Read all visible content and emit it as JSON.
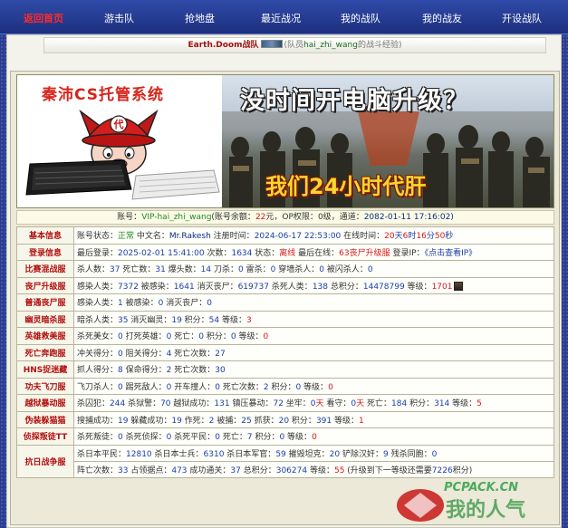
{
  "nav": {
    "home": "返回首页",
    "items": [
      "游击队",
      "抢地盘",
      "最近战况",
      "我的战队",
      "我的战友",
      "开设战队"
    ]
  },
  "subheader": {
    "team": "Earth.Doom",
    "team_suffix": "战队",
    "note_prefix": "(队员",
    "member": "hai_zhi_wang",
    "note_suffix": "的战斗经验)"
  },
  "banner": {
    "brand": "秦沛CS托管系统",
    "mascot_badge": "代",
    "headline": "没时间开电脑升级？",
    "tagline": "我们24小时代肝"
  },
  "account": {
    "label": "账号：",
    "name": "VIP-hai_zhi_wang",
    "balance_label": "(账号余额：",
    "balance": "22",
    "balance_unit": "元",
    "op_label": "OP权限：",
    "op": "0级",
    "channel_label": "通道：",
    "channel": "2082-01-11 17:16:02)"
  },
  "rows": [
    {
      "cat": "基本信息",
      "parts": [
        [
          "账号状态：",
          ""
        ],
        [
          "正常",
          "green"
        ],
        [
          " 中文名：",
          ""
        ],
        [
          "Mr.Rakesh",
          "darkblue"
        ],
        [
          " 注册时间：",
          ""
        ],
        [
          "2024-06-17 22:53:00",
          "blue"
        ],
        [
          " 在线时间：",
          ""
        ],
        [
          "20",
          "red"
        ],
        [
          "天",
          "blue"
        ],
        [
          "6",
          "red"
        ],
        [
          "时",
          "blue"
        ],
        [
          "16",
          "red"
        ],
        [
          "分",
          "blue"
        ],
        [
          "50",
          "red"
        ],
        [
          "秒",
          "blue"
        ]
      ]
    },
    {
      "cat": "登录信息",
      "parts": [
        [
          "最后登录：",
          ""
        ],
        [
          "2025-02-01 15:41:00",
          "blue"
        ],
        [
          " 次数：",
          ""
        ],
        [
          "1634",
          "blue"
        ],
        [
          " 状态：",
          ""
        ],
        [
          "离线",
          "red"
        ],
        [
          " 最后在线：",
          ""
        ],
        [
          "63丧尸升级服",
          "red"
        ],
        [
          " 登录IP：",
          ""
        ],
        [
          "《点击查看IP》",
          "blue"
        ]
      ]
    },
    {
      "cat": "比赛混战服",
      "parts": [
        [
          "杀人数：",
          ""
        ],
        [
          "37",
          "blue"
        ],
        [
          " 死亡数：",
          ""
        ],
        [
          "31",
          "blue"
        ],
        [
          " 爆头数：",
          ""
        ],
        [
          "14",
          "blue"
        ],
        [
          " 刀杀：",
          ""
        ],
        [
          "0",
          "blue"
        ],
        [
          " 雷杀：",
          ""
        ],
        [
          "0",
          "blue"
        ],
        [
          " 穿墙杀人：",
          ""
        ],
        [
          "0",
          "blue"
        ],
        [
          " 被闪杀人：",
          ""
        ],
        [
          "0",
          "blue"
        ]
      ]
    },
    {
      "cat": "丧尸升级服",
      "parts": [
        [
          "感染人类：",
          ""
        ],
        [
          "7372",
          "blue"
        ],
        [
          " 被感染：",
          ""
        ],
        [
          "1641",
          "blue"
        ],
        [
          " 消灭丧尸：",
          ""
        ],
        [
          "619737",
          "blue"
        ],
        [
          " 杀死人类：",
          ""
        ],
        [
          "138",
          "blue"
        ],
        [
          " 总积分：",
          ""
        ],
        [
          "14478799",
          "blue"
        ],
        [
          " 等级：",
          ""
        ],
        [
          "1701",
          "red"
        ]
      ],
      "avatar": true
    },
    {
      "cat": "普通丧尸服",
      "parts": [
        [
          "感染人类：",
          ""
        ],
        [
          "1",
          "blue"
        ],
        [
          " 被感染：",
          ""
        ],
        [
          "0",
          "blue"
        ],
        [
          " 消灭丧尸：",
          ""
        ],
        [
          "0",
          "blue"
        ]
      ]
    },
    {
      "cat": "幽灵暗杀服",
      "parts": [
        [
          "暗杀人类：",
          ""
        ],
        [
          "35",
          "blue"
        ],
        [
          " 消灭幽灵：",
          ""
        ],
        [
          "19",
          "blue"
        ],
        [
          " 积分：",
          ""
        ],
        [
          "54",
          "blue"
        ],
        [
          " 等级：",
          ""
        ],
        [
          "3",
          "red"
        ]
      ]
    },
    {
      "cat": "英雄救美服",
      "parts": [
        [
          "杀死美女：",
          ""
        ],
        [
          "0",
          "blue"
        ],
        [
          " 打死英雄：",
          ""
        ],
        [
          "0",
          "blue"
        ],
        [
          " 死亡：",
          ""
        ],
        [
          "0",
          "blue"
        ],
        [
          " 积分：",
          ""
        ],
        [
          "0",
          "blue"
        ],
        [
          " 等级：",
          ""
        ],
        [
          "0",
          "red"
        ]
      ]
    },
    {
      "cat": "死亡奔跑服",
      "parts": [
        [
          "冲关得分：",
          ""
        ],
        [
          "0",
          "blue"
        ],
        [
          " 阻关得分：",
          ""
        ],
        [
          "4",
          "blue"
        ],
        [
          " 死亡次数：",
          ""
        ],
        [
          "27",
          "blue"
        ]
      ]
    },
    {
      "cat": "HNS捉迷藏",
      "parts": [
        [
          "抓人得分：",
          ""
        ],
        [
          "8",
          "blue"
        ],
        [
          " 保命得分：",
          ""
        ],
        [
          "2",
          "blue"
        ],
        [
          " 死亡次数：",
          ""
        ],
        [
          "30",
          "blue"
        ]
      ]
    },
    {
      "cat": "功夫飞刀服",
      "parts": [
        [
          "飞刀杀人：",
          ""
        ],
        [
          "0",
          "blue"
        ],
        [
          " 踢死敌人：",
          ""
        ],
        [
          "0",
          "blue"
        ],
        [
          " 开车撞人：",
          ""
        ],
        [
          "0",
          "blue"
        ],
        [
          " 死亡次数：",
          ""
        ],
        [
          "2",
          "blue"
        ],
        [
          " 积分：",
          ""
        ],
        [
          "0",
          "blue"
        ],
        [
          " 等级：",
          ""
        ],
        [
          "0",
          "red"
        ]
      ]
    },
    {
      "cat": "越狱暴动服",
      "parts": [
        [
          "杀囚犯：",
          ""
        ],
        [
          "244",
          "blue"
        ],
        [
          " 杀狱警：",
          ""
        ],
        [
          "70",
          "blue"
        ],
        [
          " 越狱成功：",
          ""
        ],
        [
          "131",
          "blue"
        ],
        [
          " 镇压暴动：",
          ""
        ],
        [
          "72",
          "blue"
        ],
        [
          " 坐牢：",
          ""
        ],
        [
          "0",
          "blue"
        ],
        [
          "天",
          "red"
        ],
        [
          " 看守：",
          ""
        ],
        [
          "0",
          "blue"
        ],
        [
          "天",
          "red"
        ],
        [
          " 死亡：",
          ""
        ],
        [
          "184",
          "blue"
        ],
        [
          " 积分：",
          ""
        ],
        [
          "314",
          "blue"
        ],
        [
          " 等级：",
          ""
        ],
        [
          "5",
          "red"
        ]
      ]
    },
    {
      "cat": "伪装躲猫猫",
      "parts": [
        [
          "搜捕成功：",
          ""
        ],
        [
          "19",
          "blue"
        ],
        [
          " 躲藏成功：",
          ""
        ],
        [
          "19",
          "blue"
        ],
        [
          " 作死：",
          ""
        ],
        [
          "2",
          "blue"
        ],
        [
          " 被捕：",
          ""
        ],
        [
          "25",
          "blue"
        ],
        [
          " 抓获：",
          ""
        ],
        [
          "20",
          "blue"
        ],
        [
          " 积分：",
          ""
        ],
        [
          "391",
          "blue"
        ],
        [
          " 等级：",
          ""
        ],
        [
          "1",
          "red"
        ]
      ]
    },
    {
      "cat": "侦探叛徒TT",
      "parts": [
        [
          "杀死叛徒：",
          ""
        ],
        [
          "0",
          "blue"
        ],
        [
          " 杀死侦探：",
          ""
        ],
        [
          "0",
          "blue"
        ],
        [
          " 杀死平民：",
          ""
        ],
        [
          "0",
          "blue"
        ],
        [
          " 死亡：",
          ""
        ],
        [
          "7",
          "blue"
        ],
        [
          " 积分：",
          ""
        ],
        [
          "0",
          "blue"
        ],
        [
          " 等级：",
          ""
        ],
        [
          "0",
          "red"
        ]
      ]
    }
  ],
  "war_row": {
    "cat": "抗日战争服",
    "line1": [
      [
        "杀日本平民：",
        ""
      ],
      [
        "12810",
        "blue"
      ],
      [
        " 杀日本士兵：",
        ""
      ],
      [
        "6310",
        "blue"
      ],
      [
        " 杀日本军官：",
        ""
      ],
      [
        "59",
        "blue"
      ],
      [
        " 摧毁坦克：",
        ""
      ],
      [
        "20",
        "blue"
      ],
      [
        " 铲除汉奸：",
        ""
      ],
      [
        "9",
        "blue"
      ],
      [
        " 残杀同胞：",
        ""
      ],
      [
        "0",
        "blue"
      ]
    ],
    "line2": [
      [
        "阵亡次数：",
        ""
      ],
      [
        "33",
        "blue"
      ],
      [
        " 占领据点：",
        ""
      ],
      [
        "473",
        "blue"
      ],
      [
        " 成功通关：",
        ""
      ],
      [
        "37",
        "blue"
      ],
      [
        " 总积分：",
        ""
      ],
      [
        "306274",
        "blue"
      ],
      [
        " 等级：",
        ""
      ],
      [
        "55",
        "red"
      ],
      [
        " (升级到下一等级还需要",
        ""
      ],
      [
        "7226",
        "blue"
      ],
      [
        "积分)",
        ""
      ]
    ]
  },
  "watermark": {
    "top": "PCPACK.CN",
    "bottom": "我的人气"
  }
}
